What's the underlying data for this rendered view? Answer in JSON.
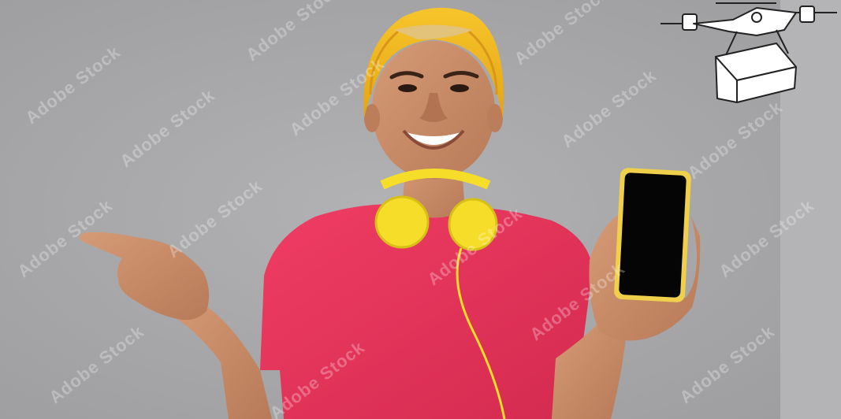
{
  "image": {
    "watermark_text": "Adobe Stock",
    "colors": {
      "background": "#a9a9ab",
      "backdrop_right_strip": "#b4b4b6",
      "shirt": "#e8325a",
      "beanie": "#f2b51c",
      "headphones": "#f5dd2a",
      "phone_frame": "#f0d04a",
      "phone_screen": "#050505",
      "skin": "#c98d6a",
      "drone_line": "#222222"
    },
    "icons": [
      "delivery-drone-icon",
      "package-box-icon"
    ]
  }
}
